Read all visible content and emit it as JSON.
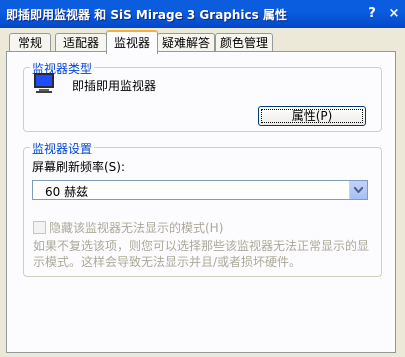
{
  "window": {
    "title": "即插即用监视器 和 SiS Mirage 3 Graphics 属性",
    "help_label": "?",
    "close_label": "×"
  },
  "tabs": [
    {
      "label": "常规"
    },
    {
      "label": "适配器"
    },
    {
      "label": "监视器",
      "active": true
    },
    {
      "label": "疑难解答"
    },
    {
      "label": "颜色管理"
    }
  ],
  "monitor_type": {
    "group_title": "监视器类型",
    "monitor_name": "即插即用监视器",
    "properties_button": "属性(P)"
  },
  "monitor_settings": {
    "group_title": "监视器设置",
    "refresh_label": "屏幕刷新频率(S):",
    "refresh_value": "60 赫兹",
    "hide_modes_label": "隐藏该监视器无法显示的模式(H)",
    "hide_modes_checked": false,
    "description": "如果不复选该项，则您可以选择那些该监视器无法正常显示的显示模式。这样会导致无法显示并且/或者损坏硬件。"
  },
  "colors": {
    "title_bar": "#0a5cdc",
    "group_title": "#0046d5",
    "disabled_text": "#aca899",
    "active_tab_accent": "#f2b33c"
  }
}
